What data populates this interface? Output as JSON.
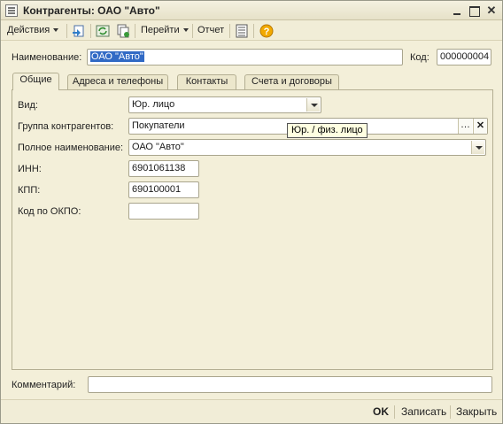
{
  "window": {
    "title": "Контрагенты: ОАО \"Авто\""
  },
  "toolbar": {
    "actions_label": "Действия",
    "goto_label": "Перейти",
    "report_label": "Отчет",
    "icons": [
      "post-icon",
      "refresh-icon",
      "copy-icon",
      "structure-icon",
      "help-icon"
    ]
  },
  "header": {
    "name_label": "Наименование:",
    "name_value": "ОАО \"Авто\"",
    "code_label": "Код:",
    "code_value": "000000004"
  },
  "tabs": [
    {
      "label": "Общие",
      "active": true
    },
    {
      "label": "Адреса и телефоны",
      "active": false
    },
    {
      "label": "Контакты",
      "active": false
    },
    {
      "label": "Счета и договоры",
      "active": false
    }
  ],
  "form": {
    "kind_label": "Вид:",
    "kind_value": "Юр. лицо",
    "group_label": "Группа контрагентов:",
    "group_value": "Покупатели",
    "fullname_label": "Полное наименование:",
    "fullname_value": "ОАО \"Авто\"",
    "inn_label": "ИНН:",
    "inn_value": "6901061138",
    "kpp_label": "КПП:",
    "kpp_value": "690100001",
    "okpo_label": "Код по ОКПО:",
    "okpo_value": ""
  },
  "tooltip": {
    "text": "Юр. / физ. лицо"
  },
  "comment": {
    "label": "Комментарий:",
    "value": ""
  },
  "footer": {
    "ok_label": "OK",
    "save_label": "Записать",
    "close_label": "Закрыть"
  },
  "colors": {
    "window_bg": "#f3efd9",
    "selection": "#316ac5",
    "tooltip_bg": "#ffffe1"
  }
}
